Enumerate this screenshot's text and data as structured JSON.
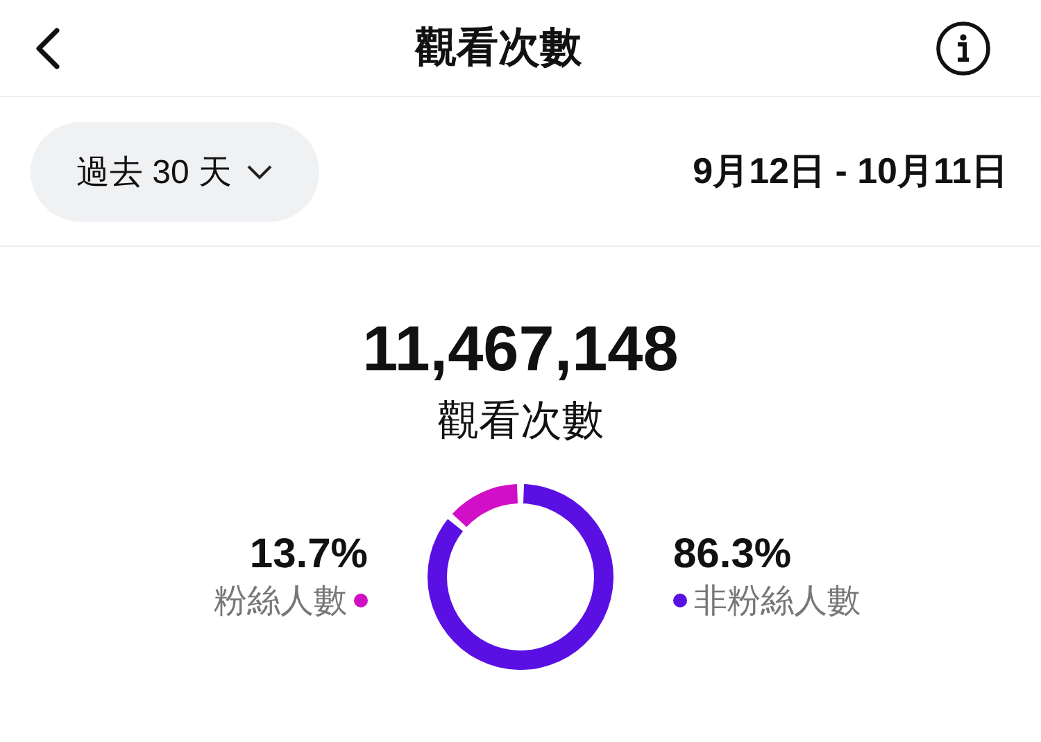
{
  "header": {
    "title": "觀看次數"
  },
  "filter": {
    "range": "過去 30 天",
    "dates": "9月12日 - 10月11日"
  },
  "summary": {
    "total": "11,467,148",
    "label": "觀看次數"
  },
  "breakdown": {
    "chart_data": {
      "type": "donut",
      "categories": [
        "粉絲人數",
        "非粉絲人數"
      ],
      "values": [
        13.7,
        86.3
      ],
      "value_labels": [
        "13.7%",
        "86.3%"
      ]
    },
    "segments": [
      {
        "color": "#d10fc6"
      },
      {
        "color": "#5a10e3"
      }
    ]
  }
}
